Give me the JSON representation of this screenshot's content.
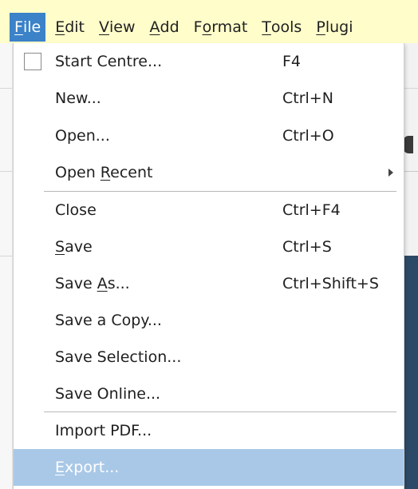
{
  "menubar": {
    "items": [
      {
        "name": "menubar-file",
        "pre": "",
        "ul": "F",
        "post": "ile",
        "active": true
      },
      {
        "name": "menubar-edit",
        "pre": "",
        "ul": "E",
        "post": "dit",
        "active": false
      },
      {
        "name": "menubar-view",
        "pre": "",
        "ul": "V",
        "post": "iew",
        "active": false
      },
      {
        "name": "menubar-add",
        "pre": "",
        "ul": "A",
        "post": "dd",
        "active": false
      },
      {
        "name": "menubar-format",
        "pre": "F",
        "ul": "o",
        "post": "rmat",
        "active": false
      },
      {
        "name": "menubar-tools",
        "pre": "",
        "ul": "T",
        "post": "ools",
        "active": false
      },
      {
        "name": "menubar-plugins",
        "pre": "",
        "ul": "P",
        "post": "lugi",
        "active": false
      }
    ]
  },
  "file_menu": {
    "items": [
      {
        "name": "menu-item-start-centre",
        "pre": "Start Centre...",
        "ul": "",
        "post": "",
        "shortcut": "F4",
        "checkbox": true
      },
      {
        "name": "menu-item-new",
        "pre": "New...",
        "ul": "",
        "post": "",
        "shortcut": "Ctrl+N"
      },
      {
        "name": "menu-item-open",
        "pre": "Open...",
        "ul": "",
        "post": "",
        "shortcut": "Ctrl+O"
      },
      {
        "name": "menu-item-open-recent",
        "pre": "Open ",
        "ul": "R",
        "post": "ecent",
        "shortcut": "",
        "submenu": true
      },
      {
        "name": "menu-item-close",
        "pre": "Close",
        "ul": "",
        "post": "",
        "shortcut": "Ctrl+F4"
      },
      {
        "name": "menu-item-save",
        "pre": "",
        "ul": "S",
        "post": "ave",
        "shortcut": "Ctrl+S"
      },
      {
        "name": "menu-item-save-as",
        "pre": "Save ",
        "ul": "A",
        "post": "s...",
        "shortcut": "Ctrl+Shift+S"
      },
      {
        "name": "menu-item-save-copy",
        "pre": "Save a Copy...",
        "ul": "",
        "post": "",
        "shortcut": ""
      },
      {
        "name": "menu-item-save-selection",
        "pre": "Save Selection...",
        "ul": "",
        "post": "",
        "shortcut": ""
      },
      {
        "name": "menu-item-save-online",
        "pre": "Save Online...",
        "ul": "",
        "post": "",
        "shortcut": ""
      },
      {
        "name": "menu-item-import-pdf",
        "pre": "Import PDF...",
        "ul": "",
        "post": "",
        "shortcut": ""
      },
      {
        "name": "menu-item-export",
        "pre": "",
        "ul": "E",
        "post": "xport...",
        "shortcut": "",
        "highlighted": true
      }
    ]
  },
  "colors": {
    "menubar_bg": "#fffecb",
    "active_menu": "#3b82c8",
    "highlight": "#a9c8e7"
  }
}
